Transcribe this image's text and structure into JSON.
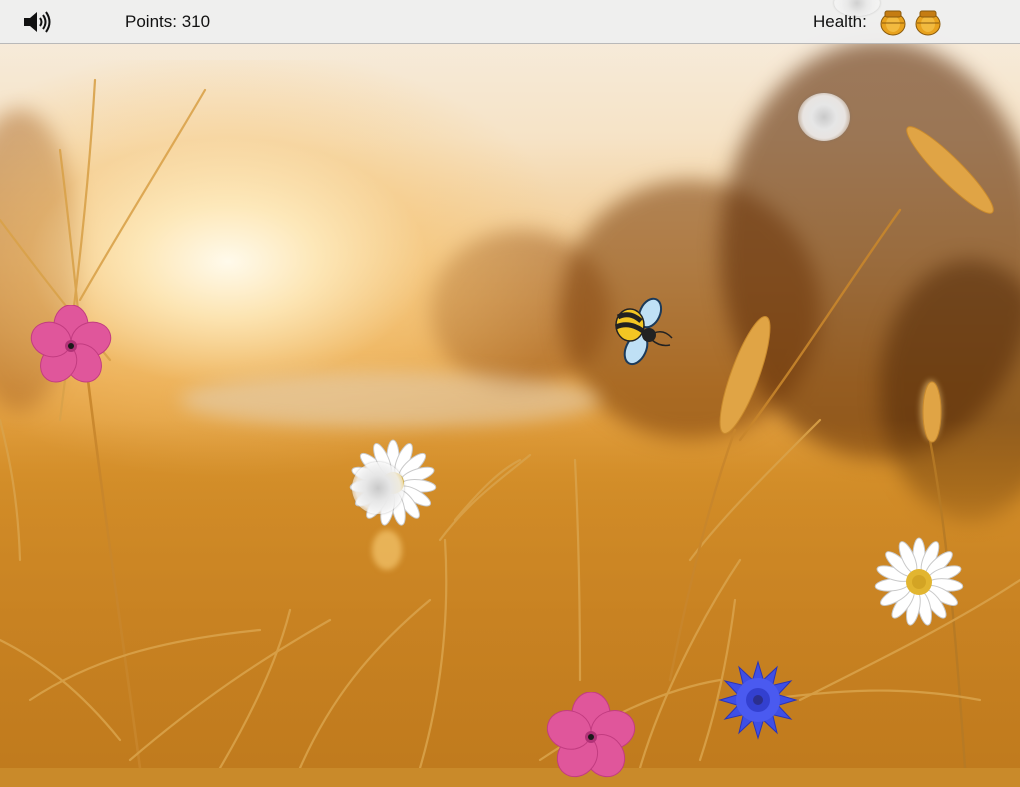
{
  "hud": {
    "sound_icon": "speaker-icon",
    "points_label": "Points:",
    "points_value": "310",
    "health_label": "Health:",
    "health_count": 2,
    "health_icon": "honey-pot-icon"
  },
  "game": {
    "player": "bee",
    "items": [
      {
        "kind": "pink-flower"
      },
      {
        "kind": "pink-flower"
      },
      {
        "kind": "daisy"
      },
      {
        "kind": "daisy"
      },
      {
        "kind": "blue-cornflower"
      },
      {
        "kind": "dandelion"
      },
      {
        "kind": "dandelion"
      },
      {
        "kind": "dandelion"
      }
    ]
  },
  "colors": {
    "hud_bg": "#eeeeee",
    "pink_flower": "#e0569b",
    "cornflower": "#3f4fe6",
    "daisy_center": "#e2b530",
    "bee_yellow": "#f3c623",
    "bee_wing": "#bfe0f5"
  }
}
